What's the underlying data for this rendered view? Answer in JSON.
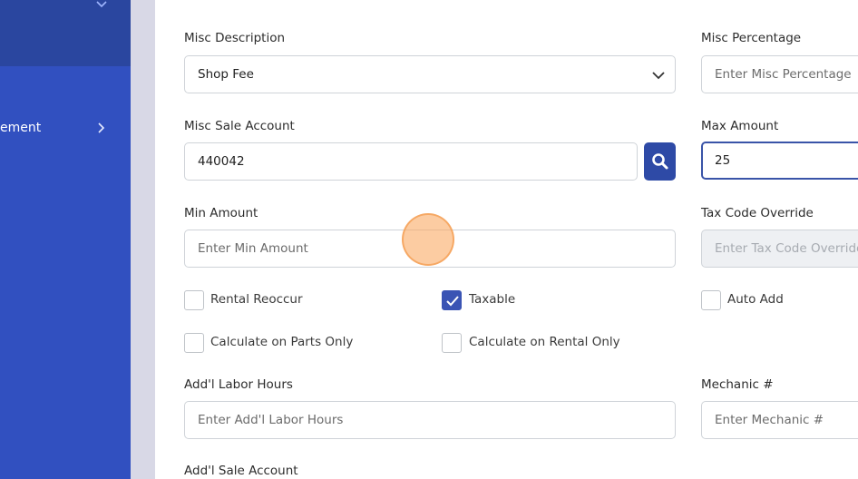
{
  "sidebar": {
    "menu_item_label": "ement"
  },
  "form": {
    "misc_description": {
      "label": "Misc Description",
      "value": "Shop Fee"
    },
    "misc_percentage": {
      "label": "Misc Percentage",
      "placeholder": "Enter Misc Percentage"
    },
    "misc_sale_account": {
      "label": "Misc Sale Account",
      "value": "440042"
    },
    "max_amount": {
      "label": "Max Amount",
      "value": "25"
    },
    "min_amount": {
      "label": "Min Amount",
      "placeholder": "Enter Min Amount"
    },
    "tax_code_override": {
      "label": "Tax Code Override",
      "placeholder": "Enter Tax Code Override"
    },
    "checkboxes": {
      "rental_reoccur": {
        "label": "Rental Reoccur",
        "checked": false
      },
      "taxable": {
        "label": "Taxable",
        "checked": true
      },
      "auto_add": {
        "label": "Auto Add",
        "checked": false
      },
      "calc_parts_only": {
        "label": "Calculate on Parts Only",
        "checked": false
      },
      "calc_rental_only": {
        "label": "Calculate on Rental Only",
        "checked": false
      }
    },
    "addl_labor_hours": {
      "label": "Add'l Labor Hours",
      "placeholder": "Enter Add'l Labor Hours"
    },
    "mechanic_no": {
      "label": "Mechanic #",
      "placeholder": "Enter Mechanic #"
    },
    "addl_sale_account": {
      "label": "Add'l Sale Account"
    }
  },
  "colors": {
    "sidebar": "#3150c0",
    "sidebar_header": "#2a469f",
    "accent": "#2e4aa6",
    "checkbox_checked": "#3a54b4",
    "focus_border": "#3a54a8"
  }
}
